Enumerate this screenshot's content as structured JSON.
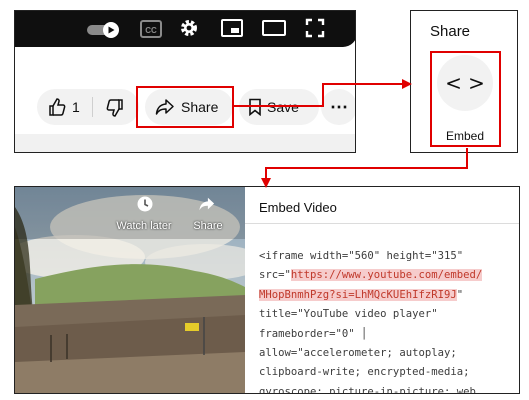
{
  "player": {
    "controls": [
      "autoplay-toggle-icon",
      "cc-icon",
      "gear-icon",
      "miniplayer-icon",
      "theater-icon",
      "fullscreen-icon"
    ],
    "cc_label": "CC"
  },
  "actions": {
    "like_count": "1",
    "share_label": "Share",
    "save_label": "Save",
    "more_label": "⋯"
  },
  "share_dialog": {
    "title": "Share",
    "embed_label": "Embed",
    "embed_glyph": "< >"
  },
  "video": {
    "watch_later_label": "Watch later",
    "share_label": "Share"
  },
  "embed": {
    "title": "Embed Video",
    "code_lines": [
      {
        "pre": "<iframe width=\"560\" height=\"315\"",
        "hl": "",
        "post": ""
      },
      {
        "pre": "src=\"",
        "hl": "https://www.youtube.com/embed/",
        "post": ""
      },
      {
        "pre": "",
        "hl": "MHopBnmhPzg?si=LhMQcKUEhIfzRI9J",
        "post": "\""
      },
      {
        "pre": "title=\"YouTube video player\"",
        "hl": "",
        "post": ""
      },
      {
        "pre": "frameborder=\"0\" │",
        "hl": "",
        "post": ""
      },
      {
        "pre": "allow=\"accelerometer; autoplay;",
        "hl": "",
        "post": ""
      },
      {
        "pre": "clipboard-write; encrypted-media;",
        "hl": "",
        "post": ""
      },
      {
        "pre": "gyroscope; picture-in-picture; web",
        "hl": "",
        "post": ""
      }
    ]
  },
  "colors": {
    "highlight_red": "#e00000",
    "code_highlight_bg": "#f6cccc",
    "player_bg": "#0f0f0f"
  }
}
